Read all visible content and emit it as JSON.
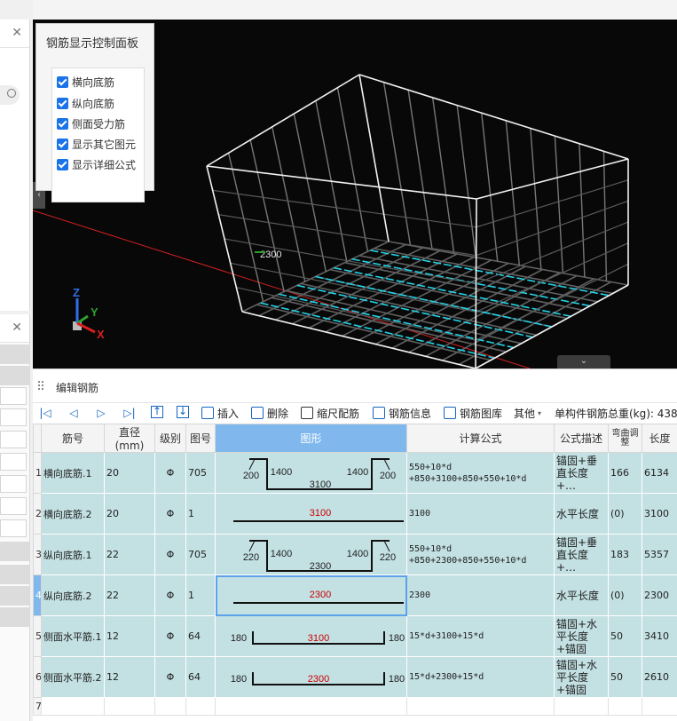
{
  "viewport": {
    "panel_title": "钢筋显示控制面板",
    "options": [
      {
        "label": "横向底筋",
        "checked": true
      },
      {
        "label": "纵向底筋",
        "checked": true
      },
      {
        "label": "侧面受力筋",
        "checked": true
      },
      {
        "label": "显示其它图元",
        "checked": true
      },
      {
        "label": "显示详细公式",
        "checked": true
      }
    ],
    "annotation_text": "2300",
    "axis_labels": {
      "x": "X",
      "y": "Y",
      "z": "Z"
    },
    "colors": {
      "background": "#080808",
      "box_edge": "#f2f2f2",
      "mesh": "#606060",
      "cyan_bars": "#22d3e6",
      "red_line": "#d42020"
    }
  },
  "editor": {
    "title": "编辑钢筋",
    "toolbar": {
      "insert": "插入",
      "delete": "删除",
      "scale": "缩尺配筋",
      "info": "钢筋信息",
      "library": "钢筋图库",
      "other": "其他",
      "total_weight": "单构件钢筋总重(kg): 438"
    },
    "columns": [
      "筋号",
      "直径(mm)",
      "级别",
      "图号",
      "图形",
      "计算公式",
      "公式描述",
      "弯曲调整",
      "长度"
    ],
    "rows": [
      {
        "no": "1",
        "name": "横向底筋.1",
        "dia": "20",
        "grade": "Φ",
        "fig": "705",
        "shape": {
          "type": "u",
          "l": "200",
          "a": "1400",
          "m": "3100",
          "b": "1400",
          "r": "200"
        },
        "formula": [
          "550+10*d",
          "+850+3100+850+550+10*d"
        ],
        "desc": "锚固+垂直长度+…",
        "bend": "166",
        "len": "6134"
      },
      {
        "no": "2",
        "name": "横向底筋.2",
        "dia": "20",
        "grade": "Φ",
        "fig": "1",
        "shape": {
          "type": "line",
          "m": "3100"
        },
        "formula": [
          "3100"
        ],
        "desc": "水平长度",
        "bend": "(0)",
        "len": "3100"
      },
      {
        "no": "3",
        "name": "纵向底筋.1",
        "dia": "22",
        "grade": "Φ",
        "fig": "705",
        "shape": {
          "type": "u",
          "l": "220",
          "a": "1400",
          "m": "2300",
          "b": "1400",
          "r": "220"
        },
        "formula": [
          "550+10*d",
          "+850+2300+850+550+10*d"
        ],
        "desc": "锚固+垂直长度+…",
        "bend": "183",
        "len": "5357"
      },
      {
        "no": "4",
        "name": "纵向底筋.2",
        "dia": "22",
        "grade": "Φ",
        "fig": "1",
        "shape": {
          "type": "line",
          "m": "2300"
        },
        "formula": [
          "2300"
        ],
        "desc": "水平长度",
        "bend": "(0)",
        "len": "2300"
      },
      {
        "no": "5",
        "name": "侧面水平筋.1",
        "dia": "12",
        "grade": "Φ",
        "fig": "64",
        "shape": {
          "type": "bracket",
          "l": "180",
          "m": "3100",
          "r": "180"
        },
        "formula": [
          "15*d+3100+15*d"
        ],
        "desc": "锚固+水平长度+锚固",
        "bend": "50",
        "len": "3410"
      },
      {
        "no": "6",
        "name": "侧面水平筋.2",
        "dia": "12",
        "grade": "Φ",
        "fig": "64",
        "shape": {
          "type": "bracket",
          "l": "180",
          "m": "2300",
          "r": "180"
        },
        "formula": [
          "15*d+2300+15*d"
        ],
        "desc": "锚固+水平长度+锚固",
        "bend": "50",
        "len": "2610"
      }
    ],
    "empty_row_no": "7"
  }
}
